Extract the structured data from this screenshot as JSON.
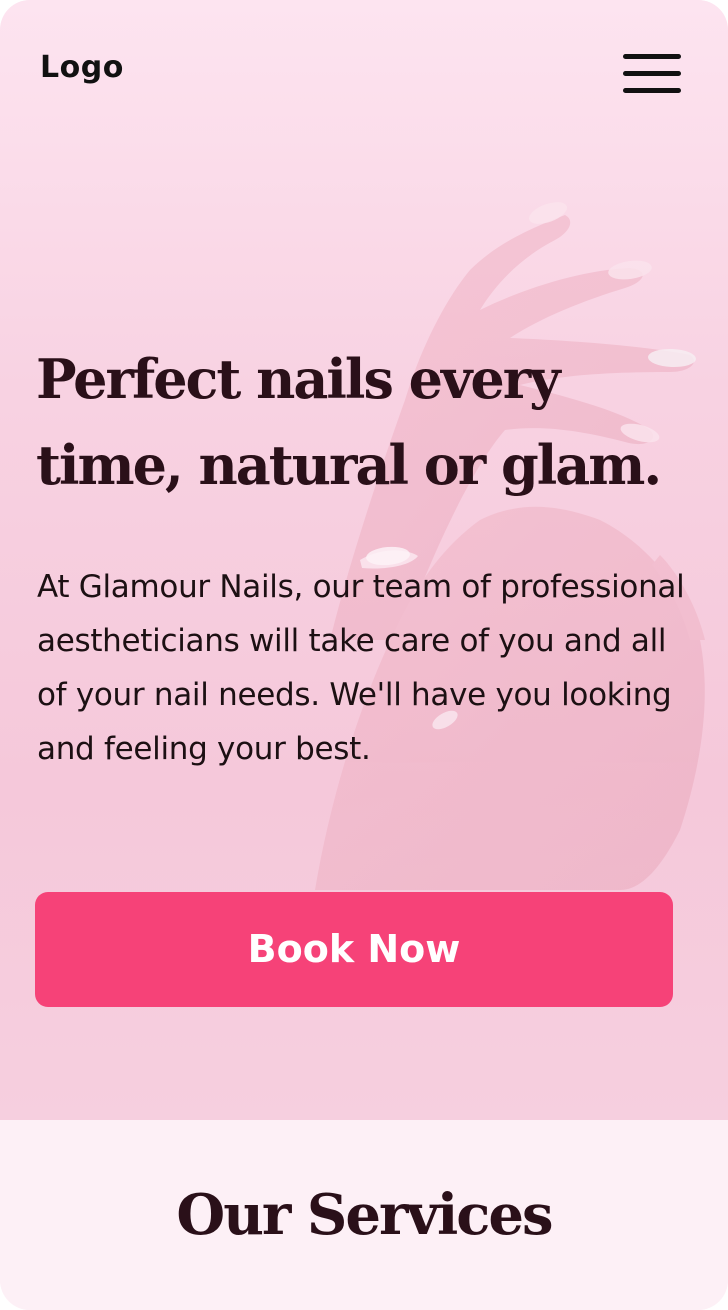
{
  "header": {
    "logo_text": "Logo",
    "menu_icon": "hamburger-menu-icon"
  },
  "hero": {
    "headline": "Perfect nails every time, natural or glam.",
    "description": "At Glamour Nails, our team of professional aestheticians will take care of you and all of your nail needs. We'll have you looking and feeling your best.",
    "cta_label": "Book Now",
    "background_image": "hands-with-pink-manicure"
  },
  "services": {
    "title": "Our Services"
  },
  "colors": {
    "accent": "#f64278",
    "hero_bg": "#f8d2e2",
    "section_bg": "#fdf0f6",
    "heading": "#2a1019"
  }
}
